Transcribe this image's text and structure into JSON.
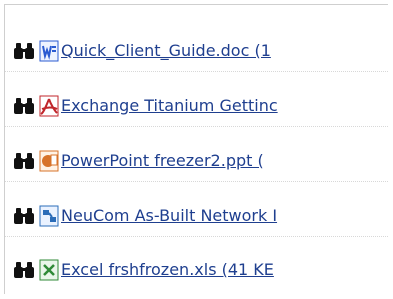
{
  "files": [
    {
      "icon": "word-doc-icon",
      "label": "Quick_Client_Guide.doc (1"
    },
    {
      "icon": "pdf-icon",
      "label": "Exchange Titanium Gettinc"
    },
    {
      "icon": "powerpoint-icon",
      "label": "PowerPoint freezer2.ppt ("
    },
    {
      "icon": "visio-icon",
      "label": "NeuCom As-Built Network I"
    },
    {
      "icon": "excel-icon",
      "label": "Excel frshfrozen.xls (41 KE"
    }
  ],
  "colors": {
    "link": "#1f3f8f",
    "accent_word": "#2b5bd1",
    "accent_pdf": "#c0262b",
    "accent_ppt": "#d7732a",
    "accent_excel": "#2f8a37",
    "accent_visio": "#2b6cb8"
  }
}
